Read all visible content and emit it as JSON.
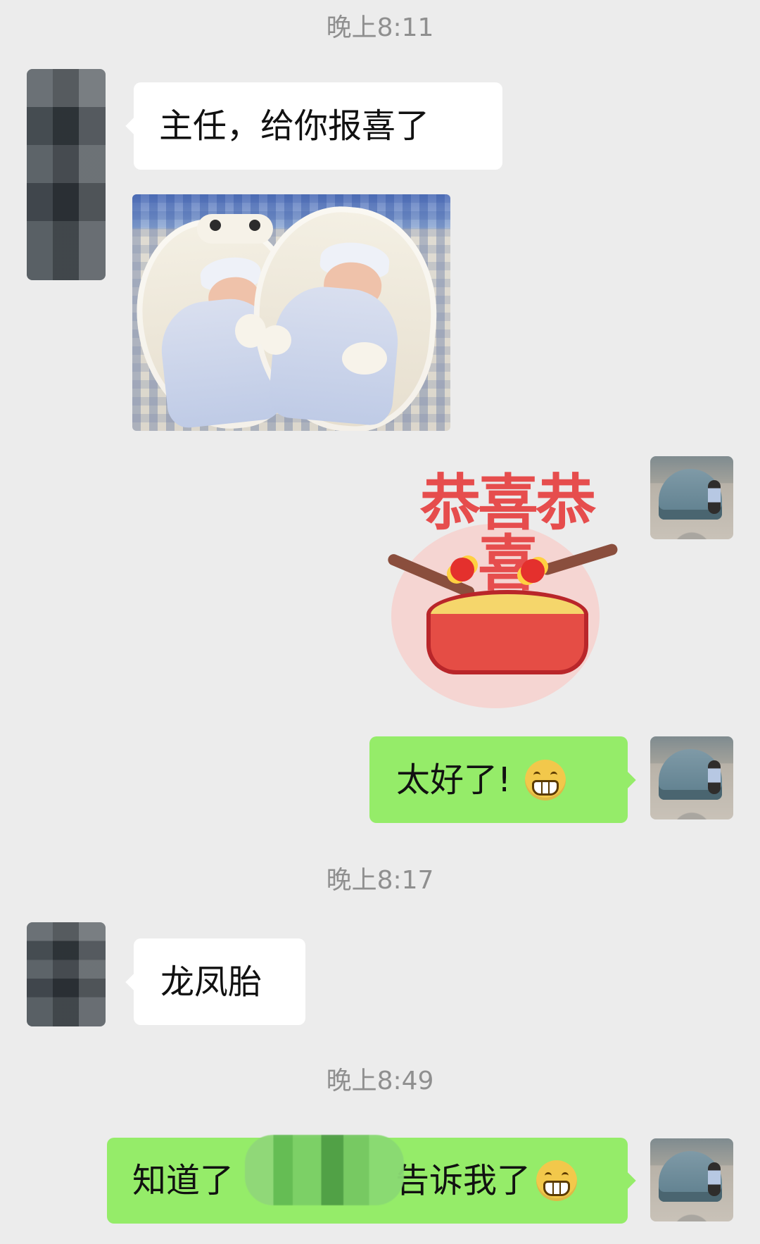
{
  "chat": {
    "timestamps": [
      "晚上8:11",
      "晚上8:17",
      "晚上8:49"
    ],
    "messages": {
      "left_1": "主任，给你报喜了",
      "sticker_title": "恭喜恭喜",
      "right_1": "太好了!",
      "left_2": "龙凤胎",
      "right_2_prefix": "知道了",
      "right_2_suffix": "告诉我了"
    }
  },
  "icons": {
    "smile": "grinning-face-icon"
  }
}
